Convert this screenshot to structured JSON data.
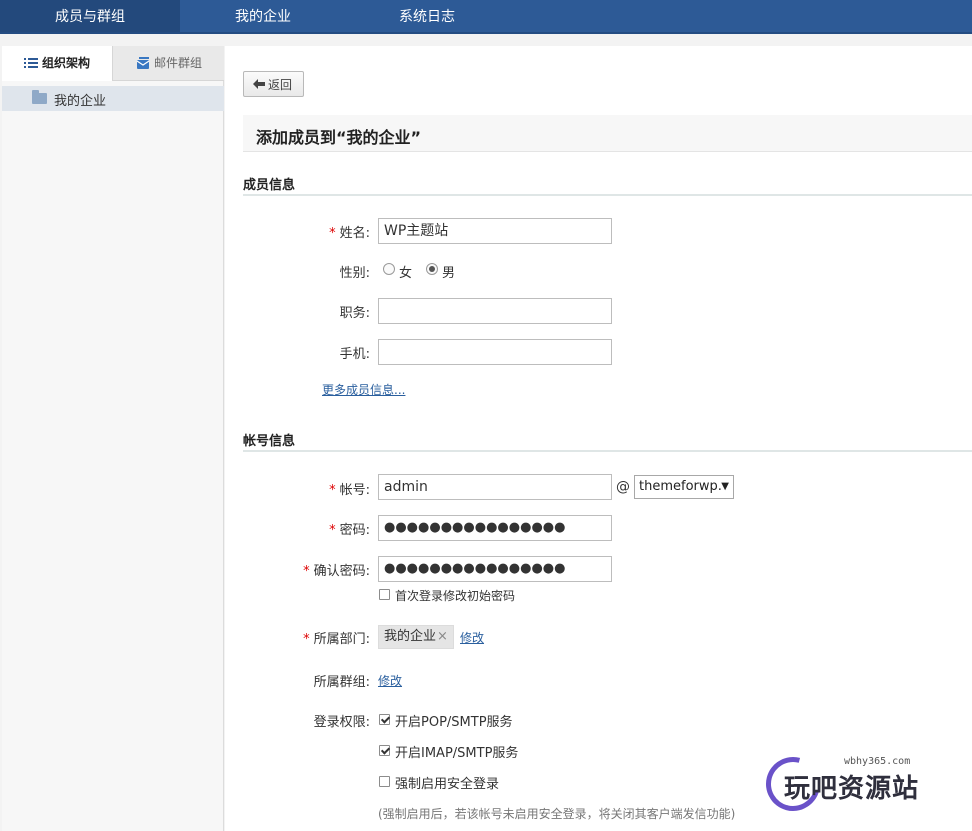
{
  "topnav": {
    "tabs": [
      {
        "label": "成员与群组",
        "active": true
      },
      {
        "label": "我的企业",
        "active": false
      },
      {
        "label": "系统日志",
        "active": false
      }
    ]
  },
  "sidebar": {
    "tabs": [
      {
        "label": "组织架构",
        "icon": "list-icon",
        "active": true
      },
      {
        "label": "邮件群组",
        "icon": "mail-group-icon",
        "active": false
      }
    ],
    "tree": [
      {
        "label": "我的企业",
        "icon": "folder-icon",
        "selected": true
      }
    ]
  },
  "main": {
    "back_label": "返回",
    "page_title": "添加成员到“我的企业”",
    "sections": {
      "member_info": "成员信息",
      "account_info": "帐号信息"
    },
    "fields": {
      "name": {
        "label": "姓名:",
        "required": true,
        "value": "WP主题站"
      },
      "gender": {
        "label": "性别:",
        "options": [
          "女",
          "男"
        ],
        "selected": "男"
      },
      "title": {
        "label": "职务:",
        "value": ""
      },
      "mobile": {
        "label": "手机:",
        "value": ""
      },
      "more_link": "更多成员信息...",
      "account": {
        "label": "帐号:",
        "required": true,
        "value": "admin",
        "at": "@",
        "domain": "themeforwp."
      },
      "password": {
        "label": "密码:",
        "required": true,
        "value": "●●●●●●●●●●●●●●●●"
      },
      "confirm_password": {
        "label": "确认密码:",
        "required": true,
        "value": "●●●●●●●●●●●●●●●●"
      },
      "first_login_change": {
        "label": "首次登录修改初始密码",
        "checked": false
      },
      "department": {
        "label": "所属部门:",
        "required": true,
        "tag": "我的企业",
        "tag_remove": "×",
        "edit": "修改"
      },
      "group": {
        "label": "所属群组:",
        "edit": "修改"
      },
      "permissions": {
        "label": "登录权限:",
        "items": [
          {
            "label": "开启POP/SMTP服务",
            "checked": true
          },
          {
            "label": "开启IMAP/SMTP服务",
            "checked": true
          },
          {
            "label": "强制启用安全登录",
            "checked": false
          }
        ],
        "note": "(强制启用后，若该帐号未启用安全登录，将关闭其客户端发信功能)"
      }
    }
  },
  "watermark": {
    "url": "wbhy365.com",
    "text": "玩吧资源站"
  },
  "colors": {
    "nav_bg": "#2d5a96",
    "nav_active": "#23497c",
    "link": "#2a5f9e",
    "required": "#dd0000",
    "watermark_ring": "#6a52c9"
  }
}
